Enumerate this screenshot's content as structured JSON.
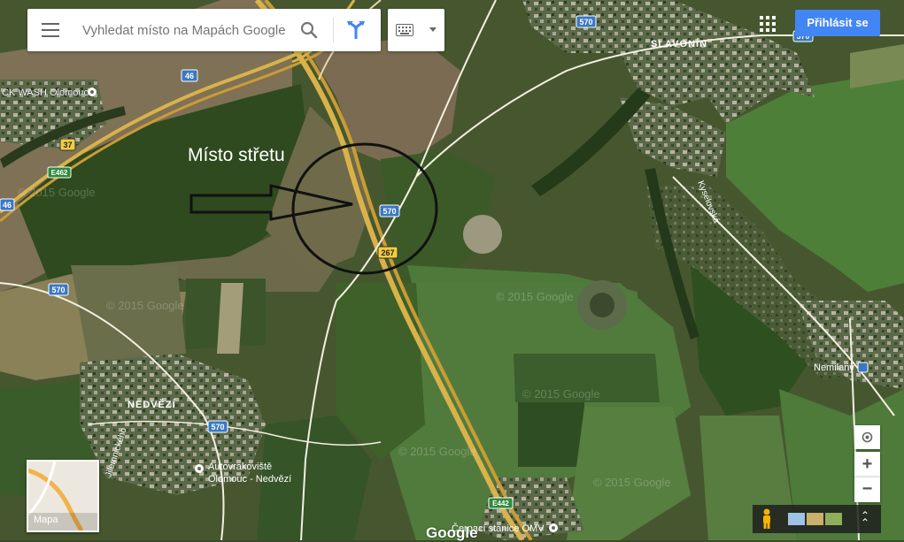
{
  "search": {
    "placeholder": "Vyhledat místo na Mapách Google"
  },
  "account": {
    "signin_label": "Přihlásit se"
  },
  "annotation": {
    "label": "Místo střetu"
  },
  "places": {
    "carwash": "CK WASH Olomouc",
    "slavonin": "SLAVONÍN",
    "nedvezi": "NEDVĚZÍ",
    "nemilany": "Nemilany",
    "autovrak_1": "Autovrakoviště",
    "autovrak_2": "Olomouc - Nedvězí",
    "omv": "Čerpací stanice OMV",
    "kyselovska": "Kyselovská",
    "jilemnickeho": "Jilemnického"
  },
  "road_shields": {
    "r570_a": "570",
    "r570_b": "570",
    "r570_c": "570",
    "r570_d": "570",
    "r570_e": "570",
    "r46_a": "46",
    "r46_b": "46",
    "r37": "37",
    "r267": "267",
    "e462": "E462",
    "e442": "E442"
  },
  "watermarks": [
    "© 2015 Google",
    "© 2015 Google",
    "© 2015 Google",
    "© 2015 Google",
    "© 2015 Google",
    "© 2015 Google"
  ],
  "zoom": {
    "in_label": "+",
    "out_label": "−"
  },
  "minimap": {
    "label": "Mapa"
  },
  "logo": "Google",
  "icons": {
    "menu": "hamburger-icon",
    "search": "search-icon",
    "directions": "directions-icon",
    "keyboard": "keyboard-icon",
    "apps": "apps-grid-icon",
    "locate": "my-location-icon",
    "pegman": "pegman-icon",
    "expand": "expand-icon"
  },
  "colors": {
    "signin_bg": "#4285f4",
    "road_shield_blue": "#3b78c2",
    "road_shield_yellow": "#f2cd3c",
    "highway": "#d9b24a"
  }
}
